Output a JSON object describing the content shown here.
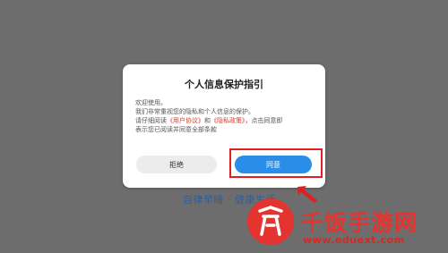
{
  "backdrop": {
    "slogan": "自律早睡 · 健康生活"
  },
  "dialog": {
    "title": "个人信息保护指引",
    "welcome": "欢迎使用。",
    "line2": "我们非常重视您的隐私和个人信息的保护。",
    "line3_prefix": "请仔细阅读",
    "user_agreement_link": "《用户协议》",
    "and_text": "和",
    "privacy_policy_link": "《隐私政策》",
    "line3_suffix": "，点击同意即",
    "line4": "表示您已阅读并同意全部条款",
    "decline_label": "拒绝",
    "agree_label": "同意"
  },
  "watermark": {
    "text": "千饭手游网",
    "url": "www.eduext.com"
  },
  "colors": {
    "accent": "#2a8ee8",
    "link": "#d2402e",
    "highlight": "#e02020",
    "watermark": "#e3342f"
  }
}
